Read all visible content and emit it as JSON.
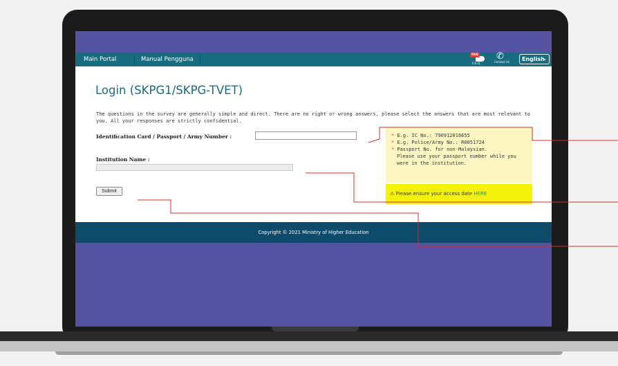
{
  "nav": {
    "items": [
      {
        "label": "Main Portal"
      },
      {
        "label": "Manual Pengguna"
      }
    ],
    "faq": {
      "badge": "FAQ",
      "label": "F.A.Q."
    },
    "contact": {
      "label": "Contact Us"
    },
    "language": {
      "selected": "English"
    }
  },
  "page": {
    "title": "Login (SKPG1/SKPG-TVET)",
    "intro": "The questions in the survey are generally simple and direct. There are no right or wrong answers, please select the answers that are most relevant to you. All your responses are strictly confidential."
  },
  "form": {
    "id_label": "Identification Card / Passport / Army Number :",
    "id_value": "",
    "institution_label": "Institution Name :",
    "institution_value": "",
    "submit_label": "Submit"
  },
  "hints": {
    "ic_example": "E.g. IC No.: 790912016655",
    "police_example": "E.g. Police/Army No.: R0051724",
    "passport_line1": "Passport No. for non-Malaysian.",
    "passport_line2": "Please use your passport number while you",
    "passport_line3": "were in the institution."
  },
  "warning": {
    "text": "Please ensure your access date ",
    "link": "HERE"
  },
  "footer": {
    "copyright": "Copyright © 2021 Ministry of Higher Education"
  },
  "colors": {
    "nav_bg": "#176c7f",
    "title": "#176c7f",
    "footer_bg": "#0e4a6a",
    "screen_bg": "#5653a3",
    "hint_bg": "#fdf6c3",
    "warning_bg": "#f4f10c",
    "required_star": "#e53935",
    "callout_line": "#d32f2f"
  }
}
